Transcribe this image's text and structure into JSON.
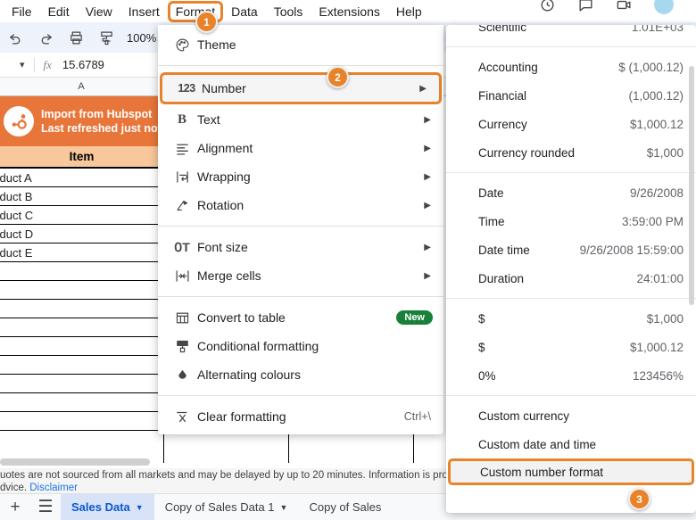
{
  "menubar": {
    "items": [
      {
        "label": "File",
        "active": false
      },
      {
        "label": "Edit",
        "active": false
      },
      {
        "label": "View",
        "active": false
      },
      {
        "label": "Insert",
        "active": false
      },
      {
        "label": "Format",
        "active": true
      },
      {
        "label": "Data",
        "active": false
      },
      {
        "label": "Tools",
        "active": false
      },
      {
        "label": "Extensions",
        "active": false
      },
      {
        "label": "Help",
        "active": false
      }
    ]
  },
  "toolbar": {
    "undo_icon": "undo-icon",
    "redo_icon": "redo-icon",
    "print_icon": "print-icon",
    "paint_format_icon": "paint-format-icon",
    "zoom_level": "100%"
  },
  "formula_bar": {
    "name_box_caret": "chevron-down-icon",
    "fx_label": "fx",
    "value": "15.6789"
  },
  "grid": {
    "column_headers": [
      "A"
    ],
    "banner": {
      "logo": "hubspot-logo-icon",
      "line1": "Import from Hubspot",
      "line2": "Last refreshed just now",
      "bg": "#E8763A"
    },
    "header_row": {
      "label": "Item",
      "bg": "#F8C79B"
    },
    "rows": [
      "roduct A",
      "roduct B",
      "roduct C",
      "roduct D",
      "roduct E",
      "",
      "",
      "",
      "",
      "",
      "",
      "",
      "",
      ""
    ]
  },
  "disclaimer": {
    "line1": "uotes are not sourced from all markets and may be delayed by up to 20 minutes. Information is provide",
    "line2_prefix": "dvice. ",
    "link": "Disclaimer"
  },
  "tabbar": {
    "add_icon": "plus-icon",
    "all_sheets_icon": "hamburger-menu-icon",
    "tabs": [
      {
        "label": "Sales Data",
        "selected": true,
        "caret": "chevron-down-icon"
      },
      {
        "label": "Copy of Sales Data 1",
        "selected": false,
        "caret": "chevron-down-icon"
      },
      {
        "label": "Copy of Sales ",
        "selected": false,
        "caret": ""
      }
    ]
  },
  "format_menu": {
    "items": [
      {
        "label": "Theme",
        "icon": "palette-icon",
        "arrow": false,
        "shortcut": "",
        "badge_new": false,
        "highlight": false,
        "sep_after": true
      },
      {
        "label": "Number",
        "icon": "number-123-icon",
        "arrow": true,
        "shortcut": "",
        "badge_new": false,
        "highlight": true,
        "sep_after": false
      },
      {
        "label": "Text",
        "icon": "bold-text-icon",
        "arrow": true,
        "shortcut": "",
        "badge_new": false,
        "highlight": false,
        "sep_after": false
      },
      {
        "label": "Alignment",
        "icon": "alignment-icon",
        "arrow": true,
        "shortcut": "",
        "badge_new": false,
        "highlight": false,
        "sep_after": false
      },
      {
        "label": "Wrapping",
        "icon": "wrapping-icon",
        "arrow": true,
        "shortcut": "",
        "badge_new": false,
        "highlight": false,
        "sep_after": false
      },
      {
        "label": "Rotation",
        "icon": "rotation-icon",
        "arrow": true,
        "shortcut": "",
        "badge_new": false,
        "highlight": false,
        "sep_after": true
      },
      {
        "label": "Font size",
        "icon": "font-size-icon",
        "arrow": true,
        "shortcut": "",
        "badge_new": false,
        "highlight": false,
        "sep_after": false
      },
      {
        "label": "Merge cells",
        "icon": "merge-cells-icon",
        "arrow": true,
        "shortcut": "",
        "badge_new": false,
        "highlight": false,
        "sep_after": true
      },
      {
        "label": "Convert to table",
        "icon": "table-icon",
        "arrow": false,
        "shortcut": "",
        "badge_new": true,
        "highlight": false,
        "sep_after": false
      },
      {
        "label": "Conditional formatting",
        "icon": "conditional-format-icon",
        "arrow": false,
        "shortcut": "",
        "badge_new": false,
        "highlight": false,
        "sep_after": false
      },
      {
        "label": "Alternating colours",
        "icon": "droplet-icon",
        "arrow": false,
        "shortcut": "",
        "badge_new": false,
        "highlight": false,
        "sep_after": true
      },
      {
        "label": "Clear formatting",
        "icon": "clear-formatting-icon",
        "arrow": false,
        "shortcut": "Ctrl+\\",
        "badge_new": false,
        "highlight": false,
        "sep_after": false
      }
    ],
    "new_badge_label": "New"
  },
  "number_menu": {
    "items": [
      {
        "label": "Scientific",
        "value": "1.01E+03",
        "highlight": false,
        "sep_after": true
      },
      {
        "label": "Accounting",
        "value": "$ (1,000.12)",
        "highlight": false,
        "sep_after": false
      },
      {
        "label": "Financial",
        "value": "(1,000.12)",
        "highlight": false,
        "sep_after": false
      },
      {
        "label": "Currency",
        "value": "$1,000.12",
        "highlight": false,
        "sep_after": false
      },
      {
        "label": "Currency rounded",
        "value": "$1,000",
        "highlight": false,
        "sep_after": true
      },
      {
        "label": "Date",
        "value": "9/26/2008",
        "highlight": false,
        "sep_after": false
      },
      {
        "label": "Time",
        "value": "3:59:00 PM",
        "highlight": false,
        "sep_after": false
      },
      {
        "label": "Date time",
        "value": "9/26/2008 15:59:00",
        "highlight": false,
        "sep_after": false
      },
      {
        "label": "Duration",
        "value": "24:01:00",
        "highlight": false,
        "sep_after": true
      },
      {
        "label": "$",
        "value": "$1,000",
        "highlight": false,
        "sep_after": false
      },
      {
        "label": "$",
        "value": "$1,000.12",
        "highlight": false,
        "sep_after": false
      },
      {
        "label": "0%",
        "value": "123456%",
        "highlight": false,
        "sep_after": true
      },
      {
        "label": "Custom currency",
        "value": "",
        "highlight": false,
        "sep_after": false
      },
      {
        "label": "Custom date and time",
        "value": "",
        "highlight": false,
        "sep_after": false
      },
      {
        "label": "Custom number format",
        "value": "",
        "highlight": true,
        "sep_after": false
      }
    ]
  },
  "badges": [
    {
      "number": "1"
    },
    {
      "number": "2"
    },
    {
      "number": "3"
    }
  ],
  "colors": {
    "accent_orange": "#E8832A",
    "hubspot_orange": "#E8763A",
    "header_peach": "#F8C79B",
    "selected_tab_blue": "#0b57d0",
    "link_blue": "#1a73e8",
    "new_green": "#188038"
  }
}
